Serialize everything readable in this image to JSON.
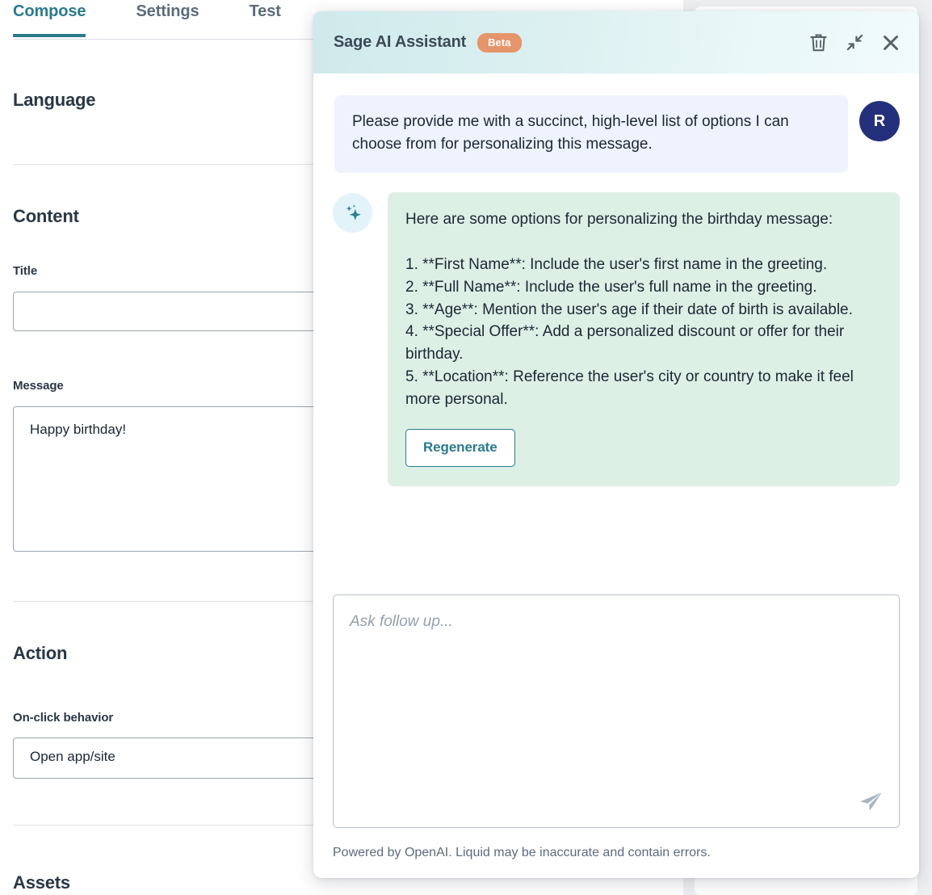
{
  "editor": {
    "tabs": [
      {
        "label": "Compose",
        "active": true
      },
      {
        "label": "Settings",
        "active": false
      },
      {
        "label": "Test",
        "active": false
      }
    ],
    "sections": {
      "language": {
        "title": "Language"
      },
      "content": {
        "title": "Content",
        "title_field": {
          "label": "Title",
          "value": ""
        },
        "message_field": {
          "label": "Message",
          "value": "Happy birthday!"
        }
      },
      "action": {
        "title": "Action",
        "onclick_field": {
          "label": "On-click behavior",
          "value": "Open app/site"
        }
      },
      "assets": {
        "title": "Assets"
      }
    }
  },
  "sage": {
    "title": "Sage AI Assistant",
    "badge": "Beta",
    "header_icons": {
      "delete": "trash-icon",
      "minimize": "minimize-icon",
      "close": "close-icon"
    },
    "messages": [
      {
        "role": "user",
        "avatar_initial": "R",
        "text": "Please provide me with a succinct, high-level list of options I can choose from for personalizing this message."
      },
      {
        "role": "assistant",
        "icon": "sparkle-icon",
        "text": "Here are some options for personalizing the birthday message:\n\n1. **First Name**: Include the user's first name in the greeting.\n2. **Full Name**: Include the user's full name in the greeting.\n3. **Age**: Mention the user's age if their date of birth is available.\n4. **Special Offer**: Add a personalized discount or offer for their birthday.\n5. **Location**: Reference the user's city or country to make it feel more personal.",
        "action_label": "Regenerate"
      }
    ],
    "composer": {
      "placeholder": "Ask follow up...",
      "value": "",
      "send_icon": "send-icon"
    },
    "footer": "Powered by OpenAI. Liquid may be inaccurate and contain errors."
  },
  "colors": {
    "accent_teal": "#2b7a8c",
    "badge_orange": "#e6956b",
    "avatar_navy": "#25307c",
    "assistant_bubble": "#ddf0e6",
    "user_bubble": "#eef3fd",
    "header_gradient_start": "#cfeaec",
    "header_gradient_end": "#f2fbfb"
  }
}
